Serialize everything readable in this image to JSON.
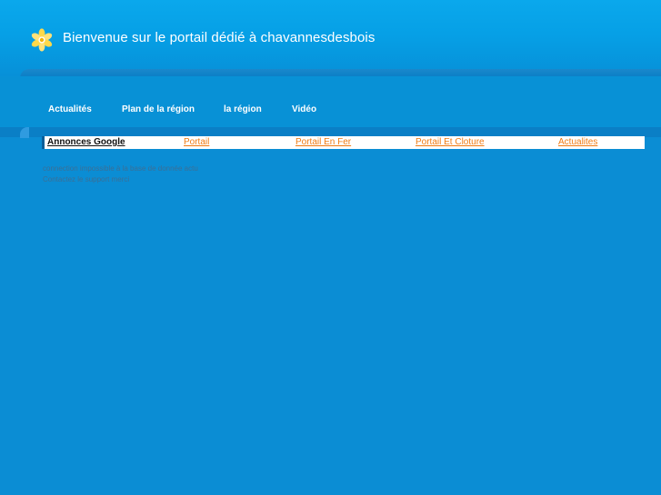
{
  "header": {
    "title": "Bienvenue sur le portail dédié à chavannesdesbois",
    "logo_icon": "flower-icon"
  },
  "nav": {
    "items": [
      {
        "label": "Actualités"
      },
      {
        "label": "Plan de la région"
      },
      {
        "label": "la région"
      },
      {
        "label": "Vidéo"
      }
    ]
  },
  "ads": {
    "heading": "Annonces Google",
    "links": [
      {
        "label": "Portail"
      },
      {
        "label": "Portail En Fer"
      },
      {
        "label": "Portail Et Cloture"
      },
      {
        "label": "Actualites"
      }
    ]
  },
  "message": {
    "line1": "connection impossible à la base de donnée actu",
    "line2": "Contactez le support merci"
  },
  "colors": {
    "accent": "#0b8dd4",
    "link": "#f07a12"
  }
}
